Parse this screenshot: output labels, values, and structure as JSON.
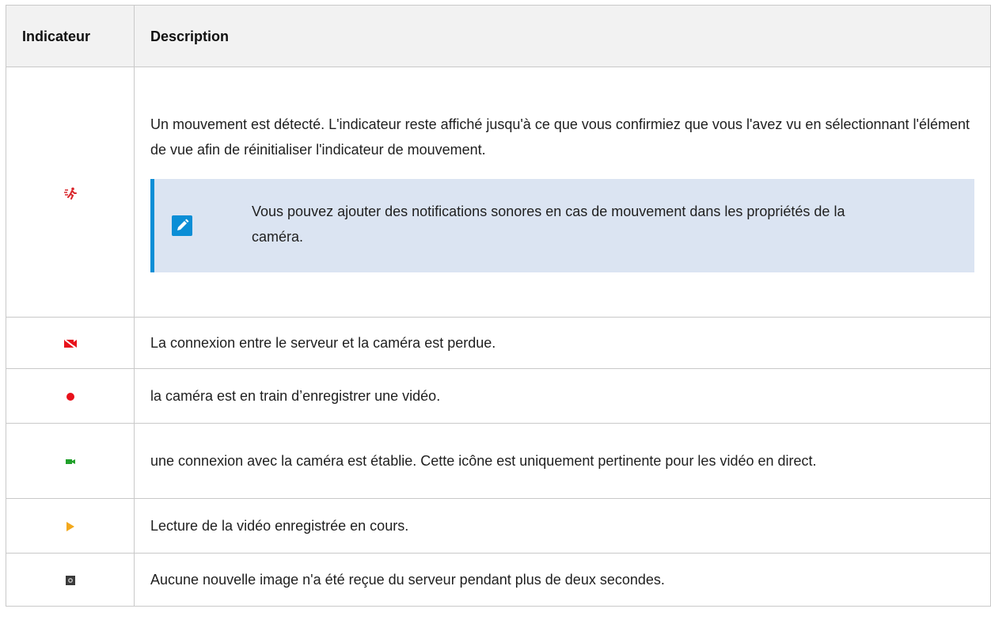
{
  "table": {
    "headers": [
      "Indicateur",
      "Description"
    ],
    "rows": [
      {
        "icon": "motion-running-person-icon",
        "description": "Un mouvement est détecté. L'indicateur reste affiché jusqu'à ce que vous confirmiez que vous l'avez vu en sélectionnant l'élément de vue afin de réinitialiser l'indicateur de mouvement.",
        "note": "Vous pouvez ajouter des notifications sonores en cas de mouvement dans les propriétés de la caméra."
      },
      {
        "icon": "connection-lost-camera-icon",
        "description": "La connexion entre le serveur et la caméra est perdue."
      },
      {
        "icon": "recording-dot-icon",
        "description": "la caméra est en train d’enregistrer une vidéo."
      },
      {
        "icon": "live-camera-icon",
        "description": "une connexion avec la caméra est établie. Cette icône est uniquement pertinente pour les vidéo en direct."
      },
      {
        "icon": "playback-triangle-icon",
        "description": "Lecture de la vidéo enregistrée en cours."
      },
      {
        "icon": "no-image-icon",
        "description": "Aucune nouvelle image n'a été reçue du serveur pendant plus de deux secondes."
      }
    ]
  },
  "colors": {
    "note_background": "#dbe4f2",
    "note_accent": "#0b8ed6",
    "header_background": "#f2f2f2",
    "motion": "#d9262b",
    "recording": "#e8111b",
    "live": "#20a02a",
    "playback": "#f3a81c"
  }
}
